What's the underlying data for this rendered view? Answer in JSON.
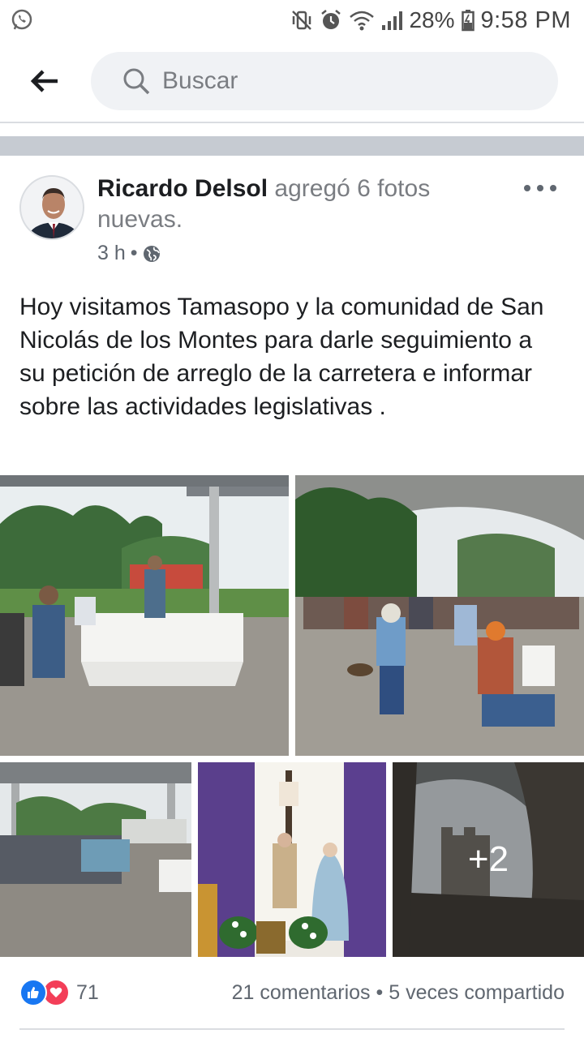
{
  "status_bar": {
    "battery": "28%",
    "time": "9:58 PM"
  },
  "search": {
    "placeholder": "Buscar"
  },
  "post": {
    "author": "Ricardo Delsol",
    "action": " agregó 6 fotos nuevas.",
    "time": "3 h",
    "separator": "•",
    "text": "Hoy visitamos Tamasopo y la comunidad de San Nicolás de los Montes para darle seguimiento a su petición de arreglo de la carretera  e informar sobre las actividades legislativas .",
    "more_photos": "+2",
    "reactions_count": "71",
    "comments": "21 comentarios",
    "shares": "5 veces compartido",
    "stats_separator": "•"
  },
  "colors": {
    "like": "#1877f2",
    "love": "#f33e58",
    "band": "#c6cbd2"
  }
}
